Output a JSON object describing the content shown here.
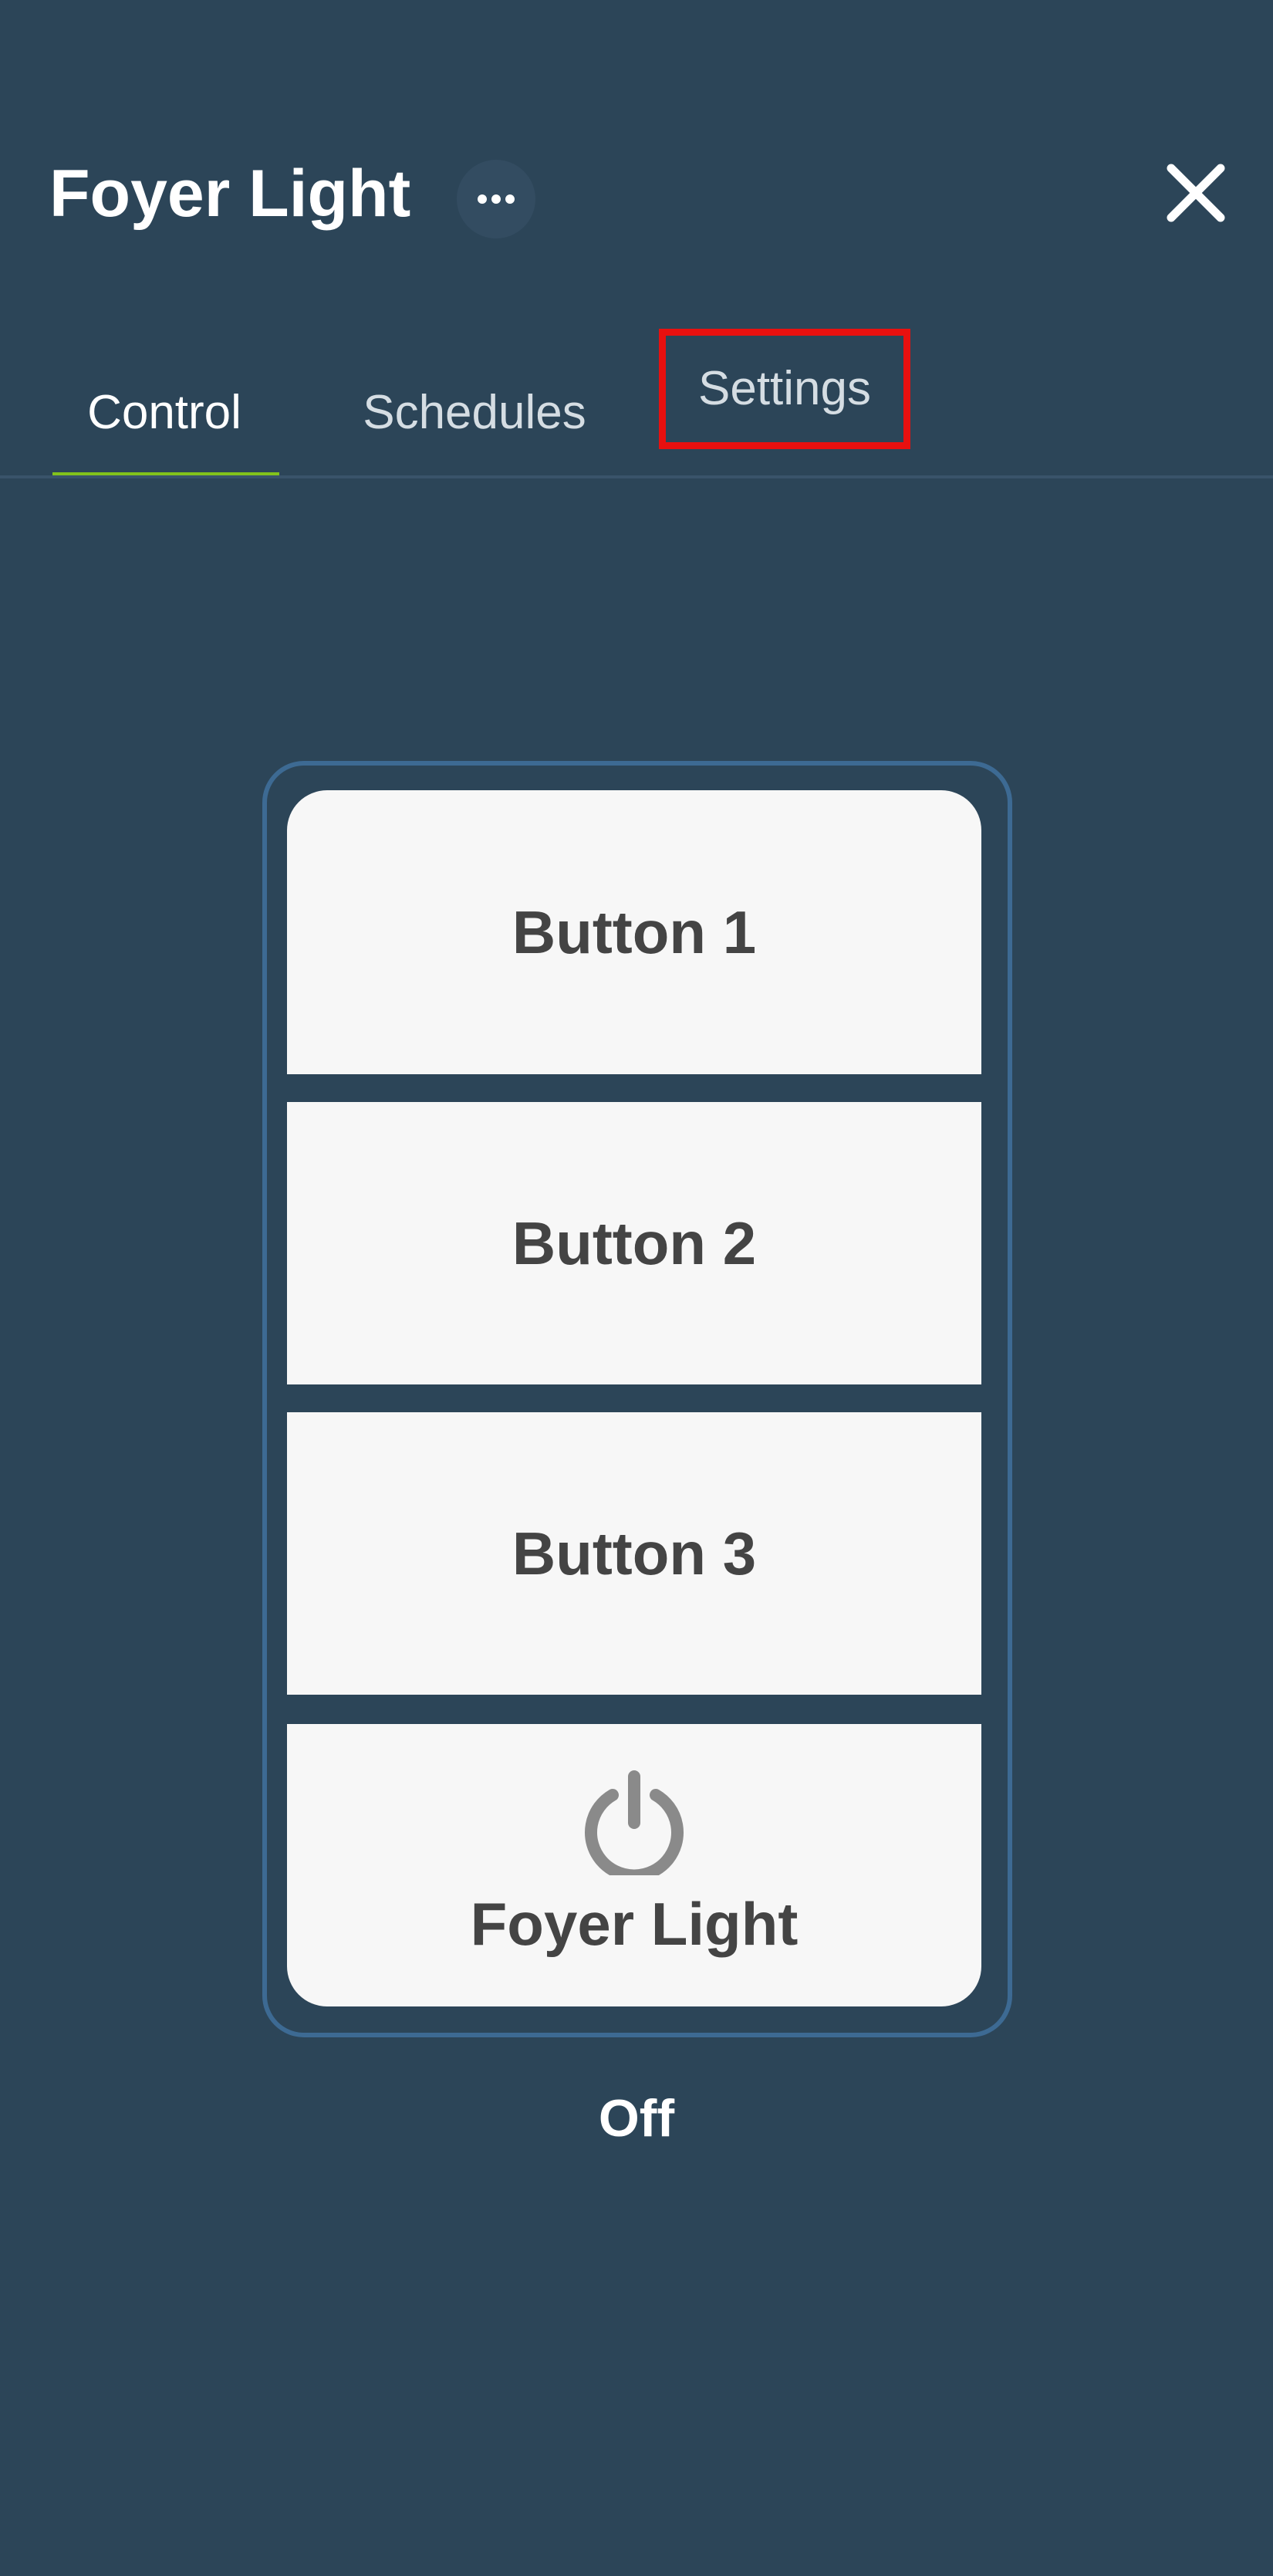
{
  "header": {
    "title": "Foyer Light",
    "more_icon": "more-horizontal-icon",
    "close_icon": "close-icon"
  },
  "tabs": [
    {
      "label": "Control",
      "active": true
    },
    {
      "label": "Schedules",
      "active": false
    },
    {
      "label": "Settings",
      "active": false,
      "highlighted": true
    }
  ],
  "keypad": {
    "buttons": [
      {
        "label": "Button 1"
      },
      {
        "label": "Button 2"
      },
      {
        "label": "Button 3"
      }
    ],
    "power_button": {
      "label": "Foyer Light",
      "icon": "power-icon"
    }
  },
  "status": "Off",
  "colors": {
    "background": "#2c4558",
    "active_tab_indicator": "#82c21b",
    "highlight_box": "#e8100f",
    "keypad_border": "#3d6a93",
    "button_face": "#f7f7f7",
    "button_text": "#444444",
    "power_icon": "#8a8a8a"
  }
}
